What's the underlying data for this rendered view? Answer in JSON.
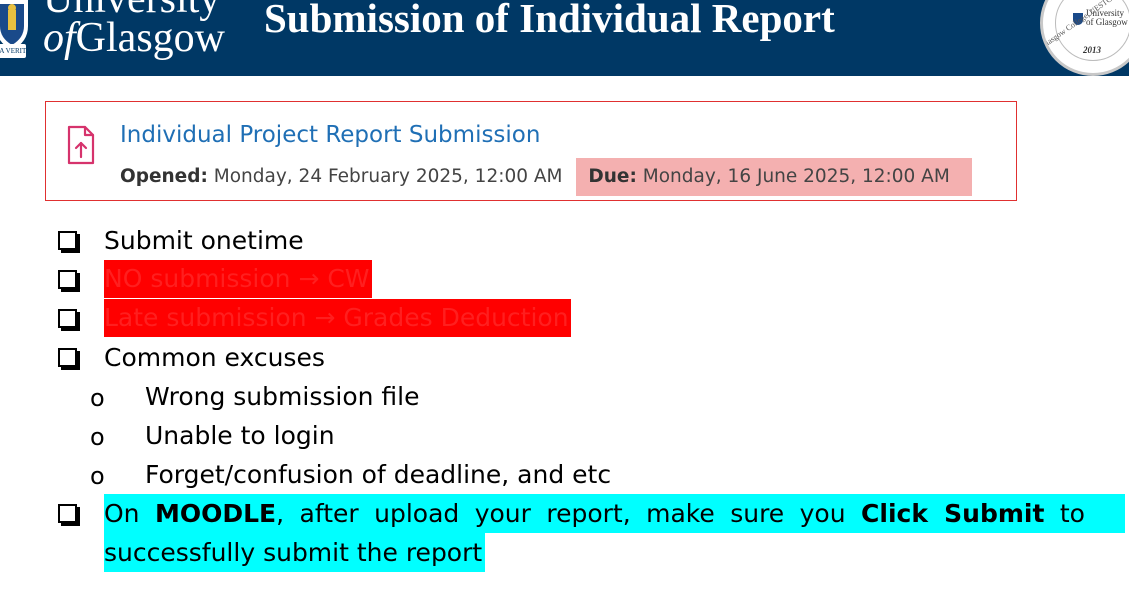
{
  "header": {
    "logo": {
      "line1": "University",
      "line2_of": "of",
      "line2_name": "Glasgow",
      "banner": "VIA VERITAS VITA"
    },
    "title": "Submission of Individual Report",
    "seal": {
      "uni": "University",
      "uni2": "of Glasgow",
      "year": "2013",
      "arc": "Glasgow College, UESTC"
    }
  },
  "assignment": {
    "title": "Individual Project Report Submission",
    "opened_label": "Opened:",
    "opened_value": "Monday, 24 February 2025, 12:00 AM",
    "due_label": "Due:",
    "due_value": "Monday, 16 June 2025, 12:00 AM",
    "icon": "file-upload-icon"
  },
  "bullets": {
    "b1": "Submit onetime",
    "b2": "NO submission → CW",
    "b3": "Late submission → Grades Deduction",
    "b4": "Common excuses",
    "sub_marker": "o",
    "s1": "Wrong submission file",
    "s2": "Unable to login",
    "s3": "Forget/confusion of deadline, and etc",
    "b5_part1": "On ",
    "b5_bold1": "MOODLE",
    "b5_part2": ", after upload your report, make sure you ",
    "b5_bold2": "Click Submit",
    "b5_part3": " to",
    "b5_line2": "successfully submit  the report"
  },
  "colors": {
    "header_bg": "#003865",
    "highlight_red": "#ff0000",
    "highlight_cyan": "#00ffff",
    "due_bg": "#f4b0b0",
    "link_blue": "#1f6fb5"
  }
}
